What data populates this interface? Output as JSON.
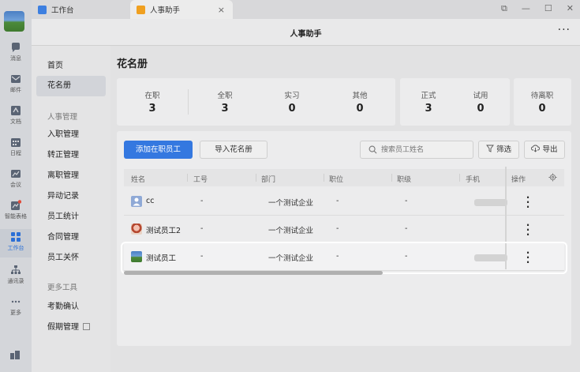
{
  "rail": {
    "items": [
      {
        "label": "消息",
        "icon": "chat-icon"
      },
      {
        "label": "邮件",
        "icon": "mail-icon"
      },
      {
        "label": "文档",
        "icon": "doc-icon"
      },
      {
        "label": "日程",
        "icon": "calendar-icon"
      },
      {
        "label": "会议",
        "icon": "meeting-icon"
      },
      {
        "label": "智能表格",
        "icon": "smart-table-icon"
      },
      {
        "label": "工作台",
        "icon": "workbench-icon"
      },
      {
        "label": "通讯录",
        "icon": "contacts-icon"
      },
      {
        "label": "更多",
        "icon": "more-icon"
      }
    ]
  },
  "tabs": {
    "tab1": "工作台",
    "tab2": "人事助手",
    "close": "×"
  },
  "window": {
    "restore": "⧉",
    "minimize": "—",
    "maximize": "☐",
    "close": "✕"
  },
  "header": {
    "title": "人事助手",
    "more": "···"
  },
  "sidebar": {
    "home": "首页",
    "roster": "花名册",
    "group_hr": "人事管理",
    "onboarding": "入职管理",
    "regularization": "转正管理",
    "offboarding": "离职管理",
    "change_log": "异动记录",
    "staff_stats": "员工统计",
    "contracts": "合同管理",
    "care": "员工关怀",
    "group_tools": "更多工具",
    "attendance": "考勤确认",
    "leave": "假期管理"
  },
  "page": {
    "title": "花名册"
  },
  "stats": {
    "in_service": {
      "label": "在职",
      "value": "3"
    },
    "full_time": {
      "label": "全职",
      "value": "3"
    },
    "intern": {
      "label": "实习",
      "value": "0"
    },
    "other": {
      "label": "其他",
      "value": "0"
    },
    "regular": {
      "label": "正式",
      "value": "3"
    },
    "probation": {
      "label": "试用",
      "value": "0"
    },
    "pending_leave": {
      "label": "待离职",
      "value": "0"
    }
  },
  "toolbar": {
    "add": "添加在职员工",
    "import": "导入花名册",
    "search_placeholder": "搜索员工姓名",
    "filter": "筛选",
    "export": "导出"
  },
  "table": {
    "headers": {
      "name": "姓名",
      "job_no": "工号",
      "dept": "部门",
      "position": "职位",
      "level": "职级",
      "phone": "手机",
      "ops": "操作"
    },
    "rows": [
      {
        "name": "cc",
        "job_no": "-",
        "dept": "一个测试企业",
        "position": "-",
        "level": "-"
      },
      {
        "name": "测试员工2",
        "job_no": "-",
        "dept": "一个测试企业",
        "position": "-",
        "level": "-"
      },
      {
        "name": "测试员工",
        "job_no": "-",
        "dept": "一个测试企业",
        "position": "-",
        "level": "-"
      }
    ]
  }
}
